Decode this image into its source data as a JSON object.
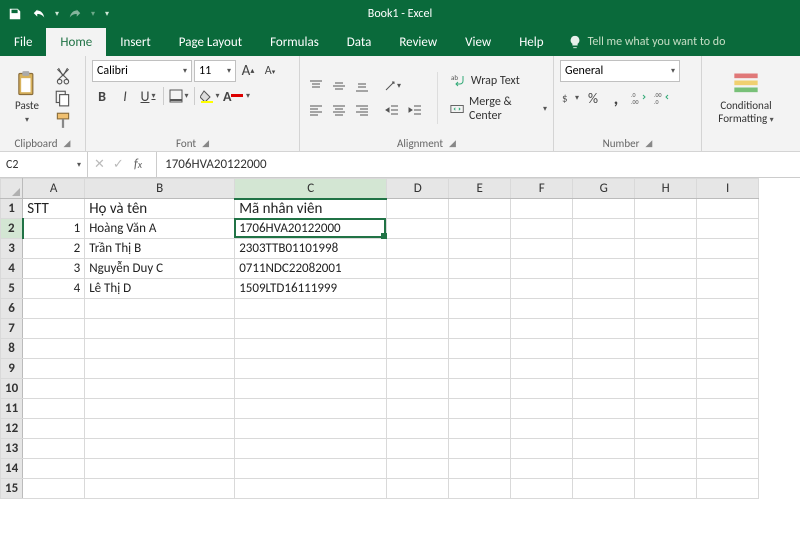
{
  "title": "Book1  -  Excel",
  "tabs": [
    "File",
    "Home",
    "Insert",
    "Page Layout",
    "Formulas",
    "Data",
    "Review",
    "View",
    "Help"
  ],
  "activeTab": "Home",
  "tellme": "Tell me what you want to do",
  "ribbon": {
    "clipboard": {
      "paste": "Paste",
      "label": "Clipboard"
    },
    "font": {
      "name": "Calibri",
      "size": "11",
      "increase": "A",
      "decrease": "A",
      "bold": "B",
      "italic": "I",
      "underline": "U",
      "font_color_letter": "A",
      "label": "Font"
    },
    "alignment": {
      "wrap": "Wrap Text",
      "merge": "Merge & Center",
      "label": "Alignment"
    },
    "number": {
      "format": "General",
      "label": "Number"
    },
    "styles": {
      "conditional": "Conditional Formatting",
      "cond_l1": "Conditional",
      "cond_l2": "Formatting"
    }
  },
  "namebox": "C2",
  "formula": "1706HVA20122000",
  "columns": [
    "A",
    "B",
    "C",
    "D",
    "E",
    "F",
    "G",
    "H",
    "I"
  ],
  "rows": 15,
  "selectedCell": {
    "row": 2,
    "col": "C"
  },
  "headerRow": {
    "A": "STT",
    "B": "Họ và tên",
    "C": "Mã nhân viên"
  },
  "data": [
    {
      "stt": "1",
      "name": "Hoàng Văn A",
      "code": "1706HVA20122000"
    },
    {
      "stt": "2",
      "name": "Trần Thị B",
      "code": "2303TTB01101998"
    },
    {
      "stt": "3",
      "name": "Nguyễn Duy C",
      "code": "0711NDC22082001"
    },
    {
      "stt": "4",
      "name": "Lê Thị D",
      "code": "1509LTD16111999"
    }
  ]
}
